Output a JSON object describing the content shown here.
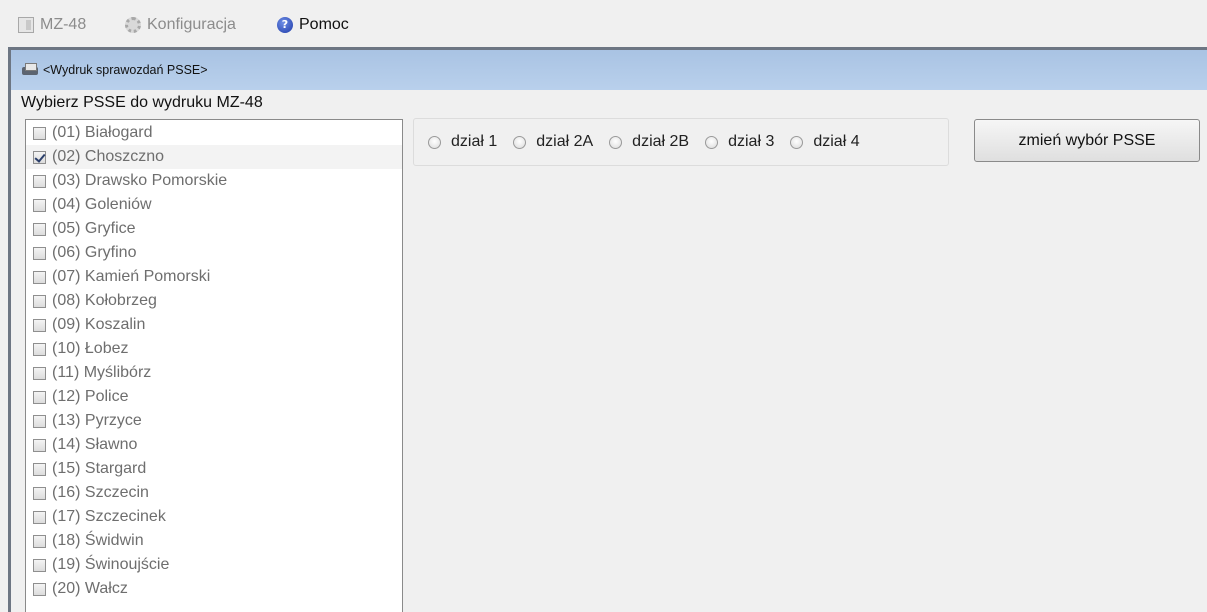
{
  "menu": {
    "items": [
      {
        "label": "MZ-48",
        "icon": "document-icon",
        "enabled": false
      },
      {
        "label": "Konfiguracja",
        "icon": "gear-icon",
        "enabled": false
      },
      {
        "label": "Pomoc",
        "icon": "help-icon",
        "enabled": true
      }
    ]
  },
  "window": {
    "title": "<Wydruk sprawozdań PSSE>"
  },
  "psse": {
    "label": "Wybierz PSSE do wydruku MZ-48",
    "items": [
      {
        "label": "(01) Białogard",
        "checked": false
      },
      {
        "label": "(02) Choszczno",
        "checked": true
      },
      {
        "label": "(03) Drawsko Pomorskie",
        "checked": false
      },
      {
        "label": "(04) Goleniów",
        "checked": false
      },
      {
        "label": "(05) Gryfice",
        "checked": false
      },
      {
        "label": "(06) Gryfino",
        "checked": false
      },
      {
        "label": "(07) Kamień Pomorski",
        "checked": false
      },
      {
        "label": "(08) Kołobrzeg",
        "checked": false
      },
      {
        "label": "(09) Koszalin",
        "checked": false
      },
      {
        "label": "(10) Łobez",
        "checked": false
      },
      {
        "label": "(11) Myślibórz",
        "checked": false
      },
      {
        "label": "(12) Police",
        "checked": false
      },
      {
        "label": "(13) Pyrzyce",
        "checked": false
      },
      {
        "label": "(14) Sławno",
        "checked": false
      },
      {
        "label": "(15) Stargard",
        "checked": false
      },
      {
        "label": "(16) Szczecin",
        "checked": false
      },
      {
        "label": "(17) Szczecinek",
        "checked": false
      },
      {
        "label": "(18) Świdwin",
        "checked": false
      },
      {
        "label": "(19) Świnoujście",
        "checked": false
      },
      {
        "label": "(20) Wałcz",
        "checked": false
      }
    ]
  },
  "sections": {
    "options": [
      "dział 1",
      "dział 2A",
      "dział 2B",
      "dział 3",
      "dział 4"
    ],
    "selected": null
  },
  "buttons": {
    "change_psse": "zmień wybór PSSE"
  }
}
